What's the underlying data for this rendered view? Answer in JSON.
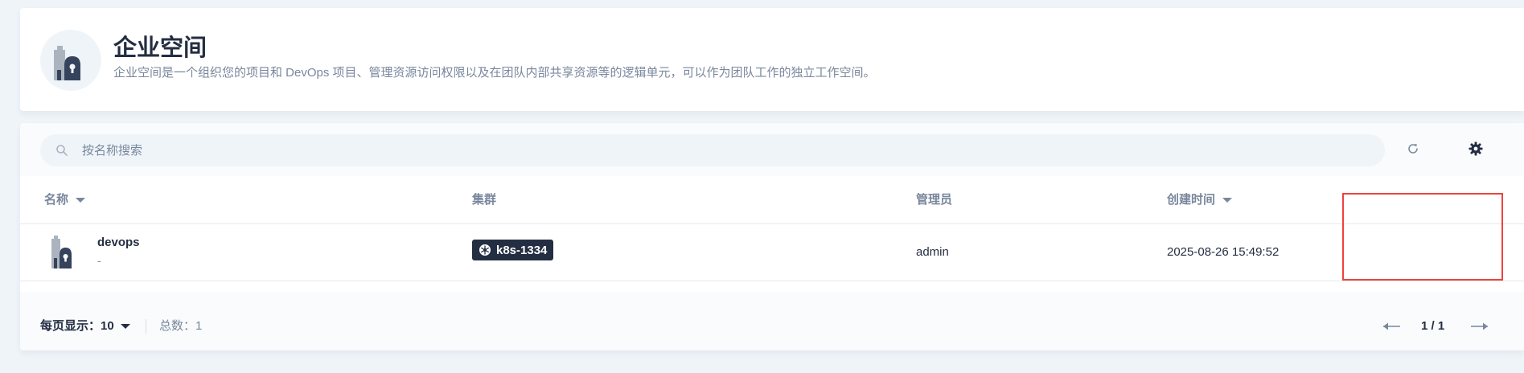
{
  "header": {
    "title": "企业空间",
    "description": "企业空间是一个组织您的项目和 DevOps 项目、管理资源访问权限以及在团队内部共享资源等的逻辑单元，可以作为团队工作的独立工作空间。",
    "icon": "workspace-building-icon"
  },
  "toolbar": {
    "search_placeholder": "按名称搜索",
    "search_value": "",
    "refresh_icon": "refresh-icon",
    "settings_icon": "gear-icon"
  },
  "table": {
    "columns": [
      "名称",
      "集群",
      "管理员",
      "创建时间"
    ],
    "rows": [
      {
        "name": "devops",
        "description": "-",
        "cluster": "k8s-1334",
        "admin": "admin",
        "created": "2025-08-26 15:49:52"
      }
    ]
  },
  "pagination": {
    "per_page_label": "每页显示：",
    "per_page_value": "10",
    "total_label": "总数：",
    "total_value": "1",
    "page_info": "1 / 1"
  },
  "colors": {
    "accent": "#242e42",
    "highlight_box": "#f0413c",
    "background": "#eff4f9"
  }
}
